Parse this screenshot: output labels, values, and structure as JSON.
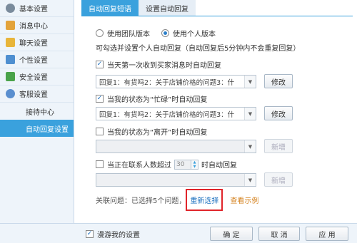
{
  "sidebar": {
    "items": [
      {
        "label": "基本设置",
        "icon": "gear-icon",
        "color": "#7a8b9c"
      },
      {
        "label": "消息中心",
        "icon": "mail-icon",
        "color": "#e3a33a"
      },
      {
        "label": "聊天设置",
        "icon": "chat-icon",
        "color": "#e8b53a"
      },
      {
        "label": "个性设置",
        "icon": "palette-icon",
        "color": "#4f8fd0"
      },
      {
        "label": "安全设置",
        "icon": "shield-icon",
        "color": "#4aa34a"
      },
      {
        "label": "客服设置",
        "icon": "service-icon",
        "color": "#5a8fcf"
      }
    ],
    "subitems": [
      {
        "label": "接待中心"
      },
      {
        "label": "自动回复设置"
      }
    ]
  },
  "tabs": [
    {
      "label": "自动回复短语"
    },
    {
      "label": "设置自动回复"
    }
  ],
  "version": {
    "team_label": "使用团队版本",
    "personal_label": "使用个人版本",
    "selected": "personal"
  },
  "hint": "可勾选并设置个人自动回复（自动回复后5分钟内不会重复回复）",
  "rule1": {
    "label": "当天第一次收到买家消息时自动回复",
    "value": "回复1：有货吗2：关于店铺价格的问题3：什",
    "button": "修改"
  },
  "rule2": {
    "label": "当我的状态为“忙碌”时自动回复",
    "value": "回复1：有货吗2：关于店铺价格的问题3：什",
    "button": "修改"
  },
  "rule3": {
    "label": "当我的状态为“离开”时自动回复",
    "value": "",
    "button": "新增"
  },
  "rule4": {
    "label_before": "当正在联系人数超过",
    "count": "30",
    "label_after": "时自动回复",
    "value": "",
    "button": "新增"
  },
  "related": {
    "text": "关联问题：已选择5个问题，",
    "reselect": "重新选择",
    "example": "查看示例"
  },
  "footer": {
    "roam_label": "漫游我的设置",
    "ok": "确 定",
    "cancel": "取 消",
    "apply": "应 用"
  },
  "colors": {
    "accent": "#3aa1dd",
    "highlight_border": "#e0242a"
  }
}
